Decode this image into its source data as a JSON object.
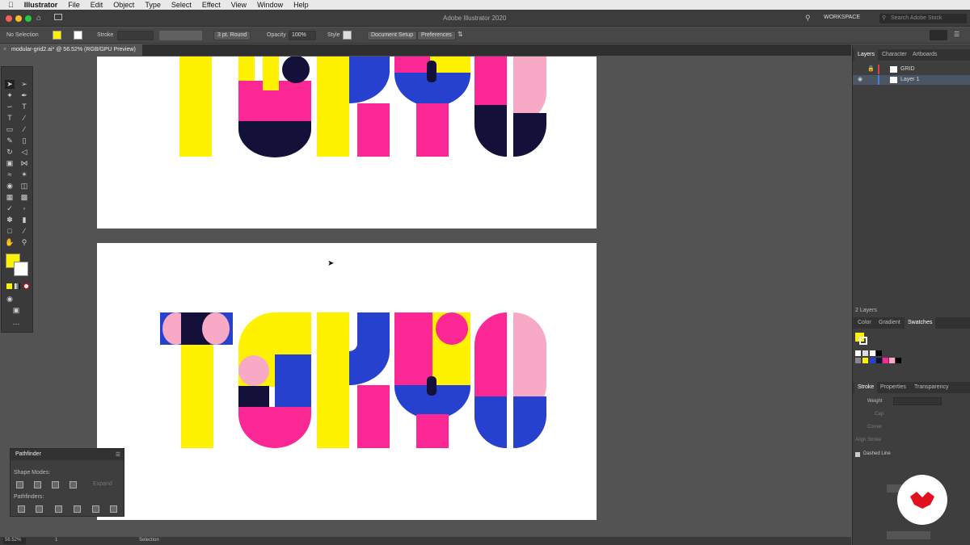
{
  "menubar": {
    "app": "Illustrator",
    "items": [
      "File",
      "Edit",
      "Object",
      "Type",
      "Select",
      "Effect",
      "View",
      "Window",
      "Help"
    ]
  },
  "titlebar": {
    "title": "Adobe Illustrator 2020",
    "workspace": "WORKSPACE",
    "search_placeholder": "Search Adobe Stock"
  },
  "control_bar": {
    "selection": "No Selection",
    "stroke_label": "Stroke",
    "brush": "3 pt. Round",
    "opacity_label": "Opacity",
    "opacity_value": "100%",
    "style_label": "Style",
    "document_setup": "Document Setup",
    "preferences": "Preferences"
  },
  "document": {
    "tab": "modular-grid2.ai* @ 56.52% (RGB/GPU Preview)",
    "zoom": "56.52%",
    "artboard": "1",
    "tool": "Selection"
  },
  "colors": {
    "yellow": "#fef200",
    "magenta": "#fb2794",
    "blue": "#2741cf",
    "navy": "#13113a",
    "pink": "#f7a9c5"
  },
  "pathfinder": {
    "title": "Pathfinder",
    "shape_modes": "Shape Modes:",
    "pathfinders": "Pathfinders:",
    "expand": "Expand"
  },
  "right_panel": {
    "tabs": [
      "Layers",
      "Character",
      "Artboards"
    ],
    "layers": [
      {
        "name": "GRID"
      },
      {
        "name": "Layer 1"
      }
    ],
    "layer_count": "2 Layers",
    "color_tabs": [
      "Color",
      "Gradient",
      "Swatches"
    ],
    "stroke_tabs": [
      "Stroke",
      "Properties",
      "Transparency"
    ],
    "stroke_weight_label": "Weight",
    "stroke_options": [
      "Cap",
      "Corner",
      "Align Stroke"
    ],
    "dashed_line": "Dashed Line"
  }
}
